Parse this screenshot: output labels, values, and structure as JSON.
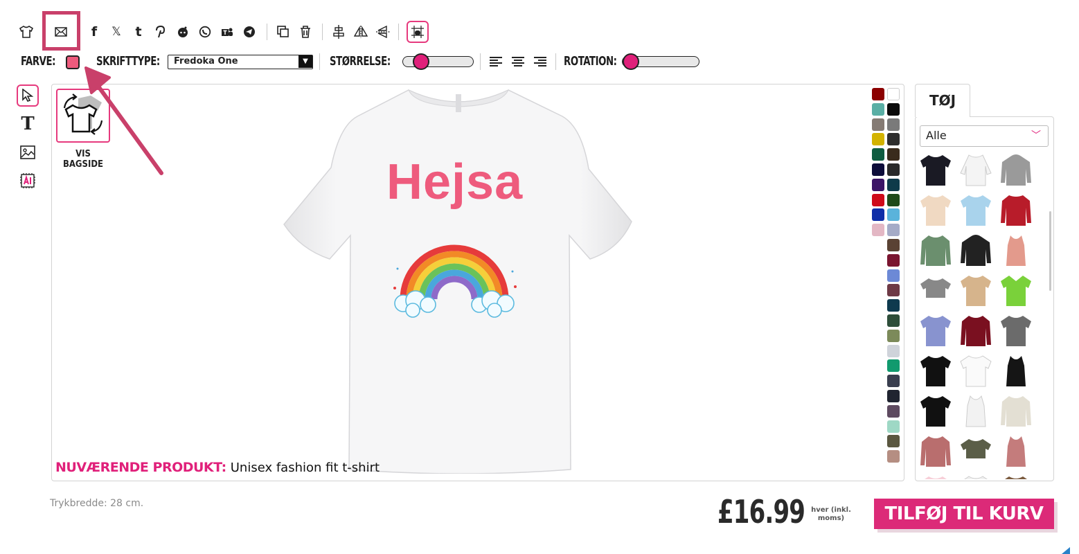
{
  "toolbar": {
    "icons": [
      "tshirt-icon",
      "email-icon",
      "facebook-icon",
      "x-icon",
      "tumblr-icon",
      "pinterest-icon",
      "reddit-icon",
      "whatsapp-icon",
      "teams-icon",
      "telegram-icon",
      "copy-icon",
      "trash-icon",
      "align-center-vertical-icon",
      "flip-horizontal-icon",
      "flip-vertical-icon",
      "grid-icon"
    ]
  },
  "options": {
    "color_label": "FARVE:",
    "color_value": "#ee5b7d",
    "font_label": "SKRIFTTYPE:",
    "font_value": "Fredoka One",
    "size_label": "STØRRELSE:",
    "size_level": 0.3,
    "rotation_label": "ROTATION:",
    "rotation_level": 0.08
  },
  "left_tools": [
    "select-icon",
    "text-icon",
    "image-icon",
    "ai-icon"
  ],
  "canvas": {
    "back_label_1": "VIS",
    "back_label_2": "BAGSIDE",
    "shirt_text": "Hejsa",
    "current_product_label": "NUVÆRENDE PRODUKT:",
    "current_product_value": "Unisex fashion fit t-shirt"
  },
  "palette": {
    "col1": [
      "#8b0000",
      "#5aafa5",
      "#857b74",
      "#d3b300",
      "#0f5c40",
      "#0d0d3a",
      "#3b1466",
      "#cf0a1a",
      "#0f2ea8",
      "#e3b7c4"
    ],
    "col2": [
      "#ffffff",
      "#0a0a0a",
      "#7a7a7a",
      "#2e2e2e",
      "#3a2b1c",
      "#2a2a2a",
      "#0e3a4a",
      "#1f4a1a",
      "#5ab3db",
      "#a5abc7",
      "#5a4234",
      "#7a1530",
      "#6c89d6",
      "#6e3a46",
      "#0e3a4e",
      "#2e4e3a",
      "#7c8a5a",
      "#cfd3da",
      "#119a6e",
      "#393e4e",
      "#202430",
      "#5e4a60",
      "#9ed8c5",
      "#5a5740",
      "#b58e82"
    ]
  },
  "right_panel": {
    "tab": "TØJ",
    "filter": "Alle"
  },
  "footer": {
    "print_width": "Trykbredde: 28 cm.",
    "price": "£16.99",
    "per_1": "hver (inkl.",
    "per_2": "moms)",
    "add_to_cart": "TILFØJ TIL KURV"
  }
}
